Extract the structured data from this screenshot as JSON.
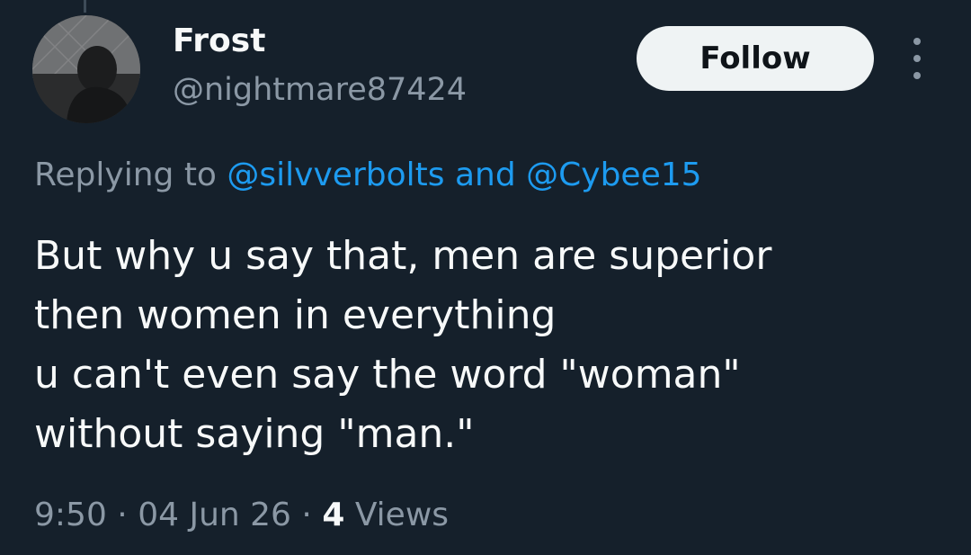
{
  "tweet": {
    "author": {
      "display_name": "Frost",
      "handle": "@nightmare87424"
    },
    "follow_label": "Follow",
    "reply_context": {
      "prefix": "Replying to",
      "mention_1": "@silvverbolts",
      "conjunction": "and",
      "mention_2": "@Cybee15"
    },
    "text_lines": [
      "But why u say that, men are superior",
      "then women in everything",
      "u can't even say the word \"woman\"",
      "without saying \"man.\""
    ],
    "time": "9:50",
    "separator": "·",
    "date": "04 Jun 26",
    "views_count": "4",
    "views_label": "Views"
  },
  "icons": {
    "more": "more-vertical-icon",
    "avatar": "profile-photo"
  },
  "colors": {
    "background": "#15202b",
    "primary_text": "#f7f9f9",
    "secondary_text": "#8b98a5",
    "link": "#1d9bf0",
    "follow_button_bg": "#eff3f4",
    "follow_button_text": "#0f1419"
  }
}
